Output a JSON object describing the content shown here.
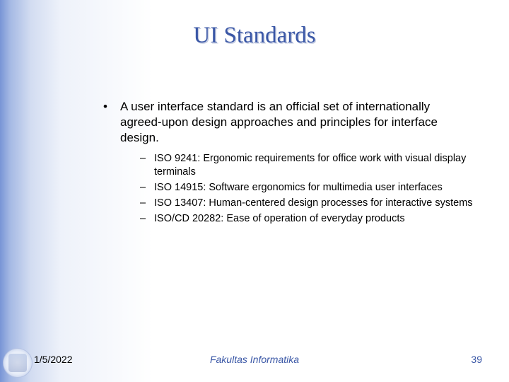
{
  "title": "UI Standards",
  "bullets": {
    "main": "A user interface standard is an official set of internationally agreed-upon design approaches and principles for interface design.",
    "subs": [
      "ISO 9241: Ergonomic requirements for office work with visual display terminals",
      "ISO 14915: Software ergonomics for multimedia user interfaces",
      "ISO 13407: Human-centered design processes for interactive systems",
      "ISO/CD 20282: Ease of operation of everyday products"
    ]
  },
  "footer": {
    "date": "1/5/2022",
    "center": "Fakultas Informatika",
    "page": "39"
  }
}
